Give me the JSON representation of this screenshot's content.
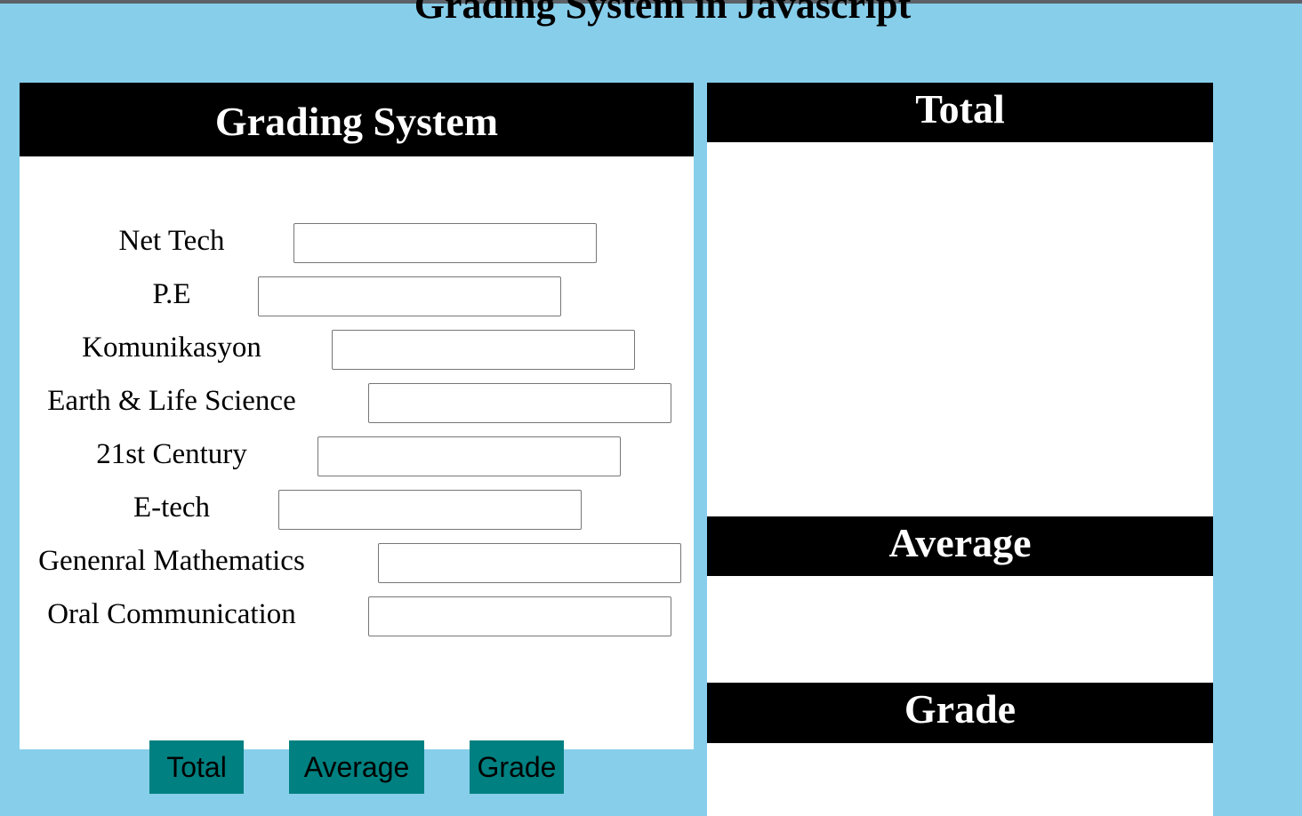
{
  "page": {
    "title": "Grading System in Javascript",
    "background": "#87ceeb"
  },
  "form": {
    "header": "Grading System",
    "subjects": [
      {
        "label": "Net Tech",
        "value": ""
      },
      {
        "label": "P.E",
        "value": ""
      },
      {
        "label": "Komunikasyon",
        "value": ""
      },
      {
        "label": "Earth & Life Science",
        "value": ""
      },
      {
        "label": "21st Century",
        "value": ""
      },
      {
        "label": "E-tech",
        "value": ""
      },
      {
        "label": "Genenral Mathematics",
        "value": ""
      },
      {
        "label": "Oral Communication",
        "value": ""
      }
    ]
  },
  "buttons": {
    "total": "Total",
    "average": "Average",
    "grade": "Grade",
    "color": "#008080"
  },
  "results": {
    "total_label": "Total",
    "total_value": "",
    "average_label": "Average",
    "average_value": "",
    "grade_label": "Grade",
    "grade_value": ""
  }
}
